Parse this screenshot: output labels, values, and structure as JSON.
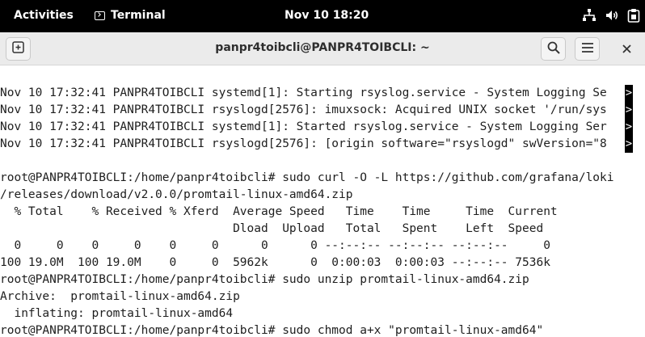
{
  "topbar": {
    "activities": "Activities",
    "app_name": "Terminal",
    "clock": "Nov 10  18:20",
    "tray_icons": [
      "network-icon",
      "volume-icon",
      "clipboard-icon"
    ]
  },
  "window": {
    "title": "panpr4toibcli@PANPR4TOIBCLI: ~",
    "buttons": {
      "new_tab": "new-tab-icon",
      "search": "search-icon",
      "menu": "hamburger-icon",
      "close": "close-icon"
    }
  },
  "terminal": {
    "lines": [
      "Nov 10 17:32:41 PANPR4TOIBCLI systemd[1]: Starting rsyslog.service - System Logging Se",
      "Nov 10 17:32:41 PANPR4TOIBCLI rsyslogd[2576]: imuxsock: Acquired UNIX socket '/run/sys",
      "Nov 10 17:32:41 PANPR4TOIBCLI systemd[1]: Started rsyslog.service - System Logging Ser",
      "Nov 10 17:32:41 PANPR4TOIBCLI rsyslogd[2576]: [origin software=\"rsyslogd\" swVersion=\"8",
      "",
      "root@PANPR4TOIBCLI:/home/panpr4toibcli# sudo curl -O -L https://github.com/grafana/loki",
      "/releases/download/v2.0.0/promtail-linux-amd64.zip",
      "  % Total    % Received % Xferd  Average Speed   Time    Time     Time  Current",
      "                                 Dload  Upload   Total   Spent    Left  Speed",
      "  0     0    0     0    0     0      0      0 --:--:-- --:--:-- --:--:--     0",
      "100 19.0M  100 19.0M    0     0  5962k      0  0:00:03  0:00:03 --:--:-- 7536k",
      "root@PANPR4TOIBCLI:/home/panpr4toibcli# sudo unzip promtail-linux-amd64.zip",
      "Archive:  promtail-linux-amd64.zip",
      "  inflating: promtail-linux-amd64",
      "root@PANPR4TOIBCLI:/home/panpr4toibcli# sudo chmod a+x \"promtail-linux-amd64\""
    ],
    "overflow_marker": ">"
  }
}
